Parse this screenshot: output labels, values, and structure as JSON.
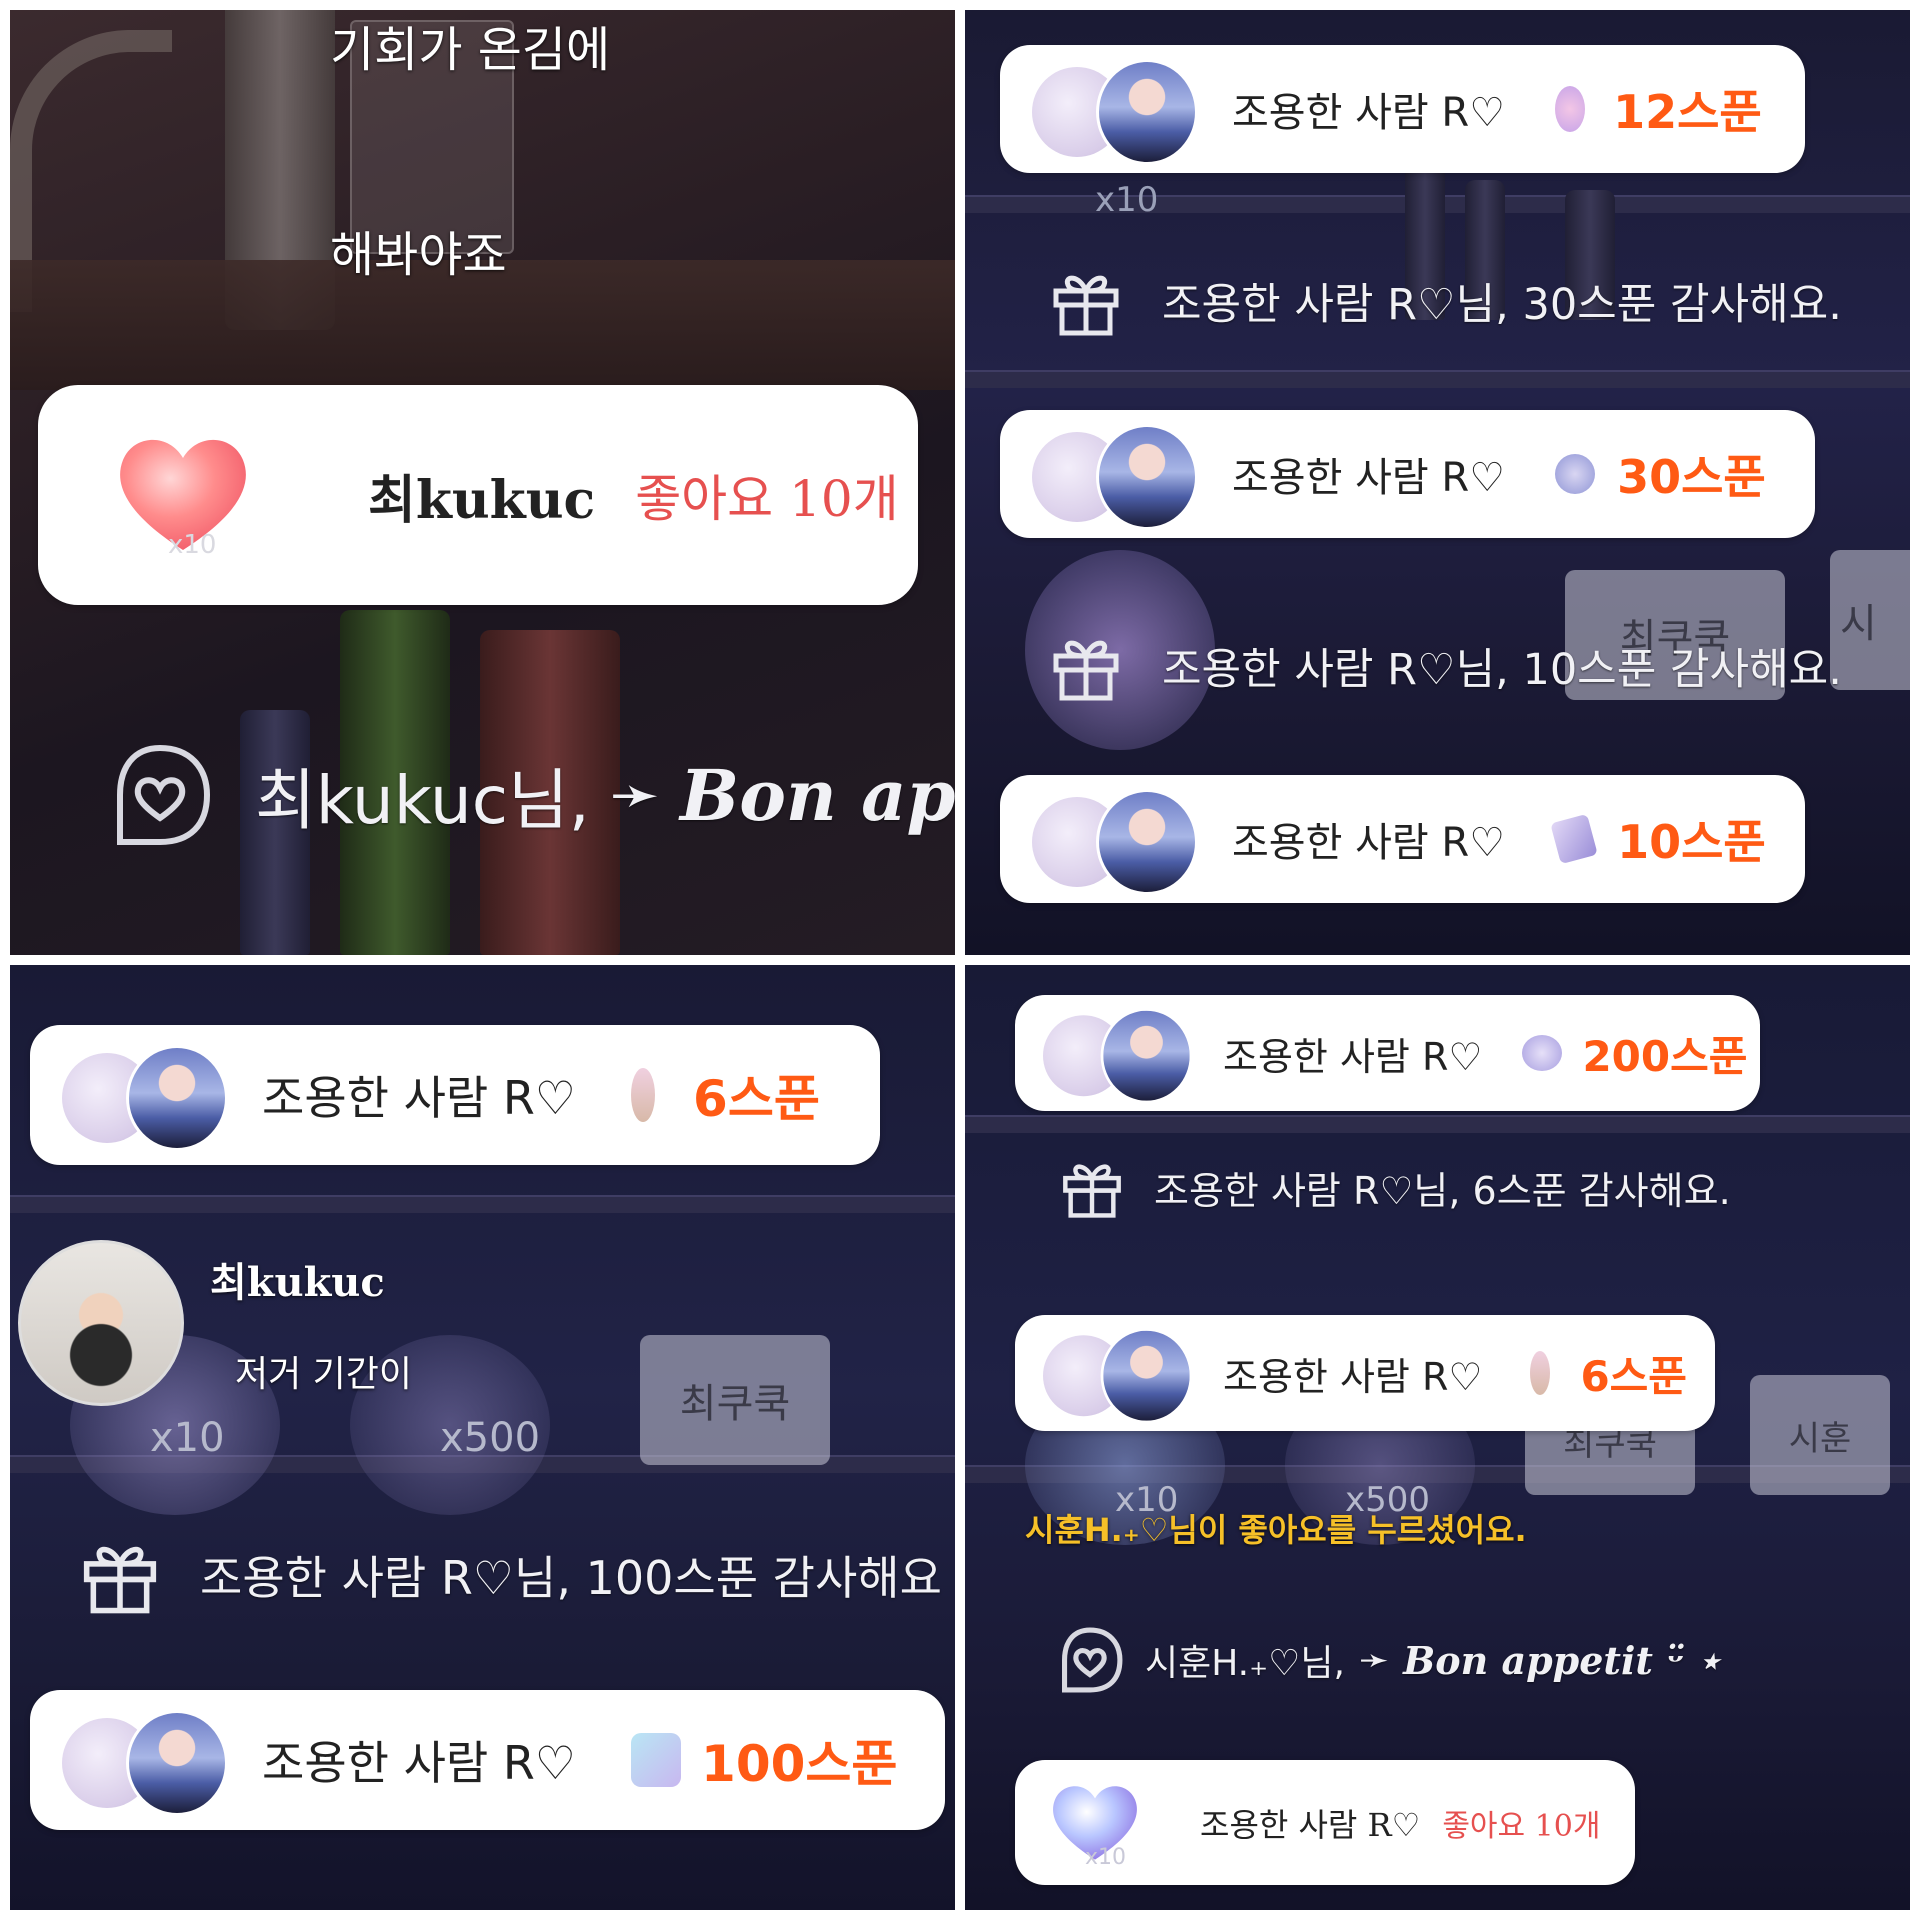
{
  "panel1": {
    "chat_line1": "기회가 온김에",
    "chat_line2": "해봐야죠",
    "like_card": {
      "x_label": "x10",
      "name": "최kukuc",
      "amount": "좋아요 10개"
    },
    "message": {
      "sender": "최kukuc님,",
      "arrow": "➛",
      "text": "Bon ap"
    }
  },
  "panel2": {
    "cards": [
      {
        "name": "조용한 사람 R♡",
        "amount": "12스푼"
      },
      {
        "name": "조용한 사람 R♡",
        "amount": "30스푼"
      },
      {
        "name": "조용한 사람 R♡",
        "amount": "10스푼"
      }
    ],
    "thanks": [
      "조용한 사람 R♡님, 30스푼 감사해요.",
      "조용한 사람 R♡님, 10스푼 감사해요."
    ],
    "bg_x10": "x10",
    "frame1": "최쿠쿡",
    "frame2": "시"
  },
  "panel3": {
    "card_top": {
      "name": "조용한 사람 R♡",
      "amount": "6스푼"
    },
    "chat": {
      "user": "최kukuc",
      "text": "저거 기간이"
    },
    "bg_x10": "x10",
    "bg_x500": "x500",
    "frame1": "최쿠쿡",
    "thanks": "조용한 사람 R♡님, 100스푼 감사해요",
    "card_bottom": {
      "name": "조용한 사람 R♡",
      "amount": "100스푼"
    }
  },
  "panel4": {
    "card_top": {
      "name": "조용한 사람 R♡",
      "amount": "200스푼"
    },
    "thanks": "조용한 사람 R♡님, 6스푼 감사해요.",
    "card_mid": {
      "name": "조용한 사람 R♡",
      "amount": "6스푼"
    },
    "frame1": "최쿠쿡",
    "frame2": "시훈",
    "bg_x10": "x10",
    "bg_x500": "x500",
    "like_notice": "시훈H.₊♡님이 좋아요를 누르셨어요.",
    "message": {
      "sender": "시훈H.₊♡님,",
      "arrow": "➛",
      "text": "Bon appetit ᵕ̈ ⋆"
    },
    "like_card": {
      "x_label": "x10",
      "name": "조용한 사람 R♡",
      "amount": "좋아요 10개"
    }
  },
  "colors": {
    "amount": "#ff5a14",
    "like": "#e6504f",
    "card_bg": "#ffffff"
  }
}
